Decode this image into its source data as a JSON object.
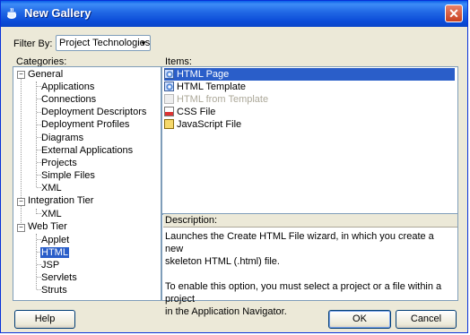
{
  "window": {
    "title": "New Gallery",
    "close_glyph": "✕"
  },
  "filter": {
    "label": "Filter By:",
    "value": "Project Technologies",
    "arrow": "▼"
  },
  "categories": {
    "label": "Categories:",
    "groups": [
      {
        "label": "General",
        "toggle": "−",
        "children": [
          "Applications",
          "Connections",
          "Deployment Descriptors",
          "Deployment Profiles",
          "Diagrams",
          "External Applications",
          "Projects",
          "Simple Files",
          "XML"
        ]
      },
      {
        "label": "Integration Tier",
        "toggle": "−",
        "children": [
          "XML"
        ]
      },
      {
        "label": "Web Tier",
        "toggle": "−",
        "children": [
          "Applet",
          "HTML",
          "JSP",
          "Servlets",
          "Struts"
        ],
        "selected": "HTML"
      }
    ]
  },
  "items": {
    "label": "Items:",
    "list": [
      {
        "label": "HTML Page",
        "icon": "html-page-icon",
        "selected": true,
        "enabled": true
      },
      {
        "label": "HTML Template",
        "icon": "html-template-icon",
        "selected": false,
        "enabled": true
      },
      {
        "label": "HTML from Template",
        "icon": "html-from-template-icon",
        "selected": false,
        "enabled": false
      },
      {
        "label": "CSS File",
        "icon": "css-file-icon",
        "selected": false,
        "enabled": true
      },
      {
        "label": "JavaScript File",
        "icon": "javascript-file-icon",
        "selected": false,
        "enabled": true
      }
    ]
  },
  "description": {
    "label": "Description:",
    "line1": "Launches the Create HTML File wizard, in which you create a new",
    "line2": "skeleton HTML (.html) file.",
    "line3": "To enable this option, you must select a project or a file within a project",
    "line4": "in the Application Navigator."
  },
  "buttons": {
    "help": "Help",
    "ok": "OK",
    "cancel": "Cancel"
  },
  "colors": {
    "selection": "#2a5ec9",
    "dialog_bg": "#ece9d8",
    "titlebar": "#0b4bd7"
  }
}
